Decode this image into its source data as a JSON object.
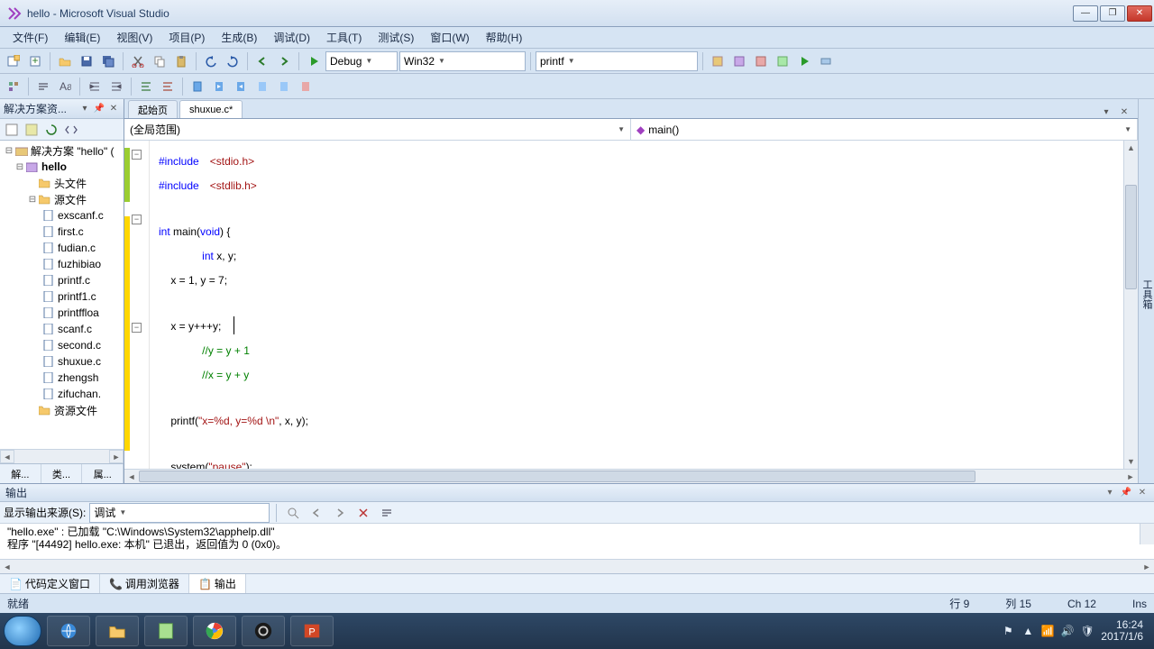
{
  "window": {
    "title": "hello - Microsoft Visual Studio"
  },
  "menu": [
    "文件(F)",
    "编辑(E)",
    "视图(V)",
    "项目(P)",
    "生成(B)",
    "调试(D)",
    "工具(T)",
    "测试(S)",
    "窗口(W)",
    "帮助(H)"
  ],
  "toolbar1": {
    "config": "Debug",
    "platform": "Win32",
    "find": "printf"
  },
  "solution_explorer": {
    "title": "解决方案资...",
    "root": "解决方案 \"hello\" (",
    "project": "hello",
    "folders": {
      "headers": "头文件",
      "sources": "源文件",
      "resources": "资源文件"
    },
    "files": [
      "exscanf.c",
      "first.c",
      "fudian.c",
      "fuzhibiao",
      "printf.c",
      "printf1.c",
      "printffloa",
      "scanf.c",
      "second.c",
      "shuxue.c",
      "zhengsh",
      "zifuchan."
    ],
    "bottom_tabs": [
      "解...",
      "类...",
      "属..."
    ]
  },
  "editor": {
    "tabs": [
      {
        "label": "起始页",
        "active": false
      },
      {
        "label": "shuxue.c*",
        "active": true
      }
    ],
    "scope": "(全局范围)",
    "member": "main()",
    "code_tokens": {
      "l1a": "#include",
      "l1b": "<stdio.h>",
      "l2a": "#include",
      "l2b": "<stdlib.h>",
      "l4a": "int",
      "l4b": " main(",
      "l4c": "void",
      "l4d": ") {",
      "l5a": "int",
      "l5b": " x, y;",
      "l6": "    x = 1, y = 7;",
      "l8": "    x = y+++y;",
      "l9": "//y = y + 1",
      "l10": "//x = y + y",
      "l12a": "    printf(",
      "l12b": "\"x=%d, y=%d \\n\"",
      "l12c": ", x, y);",
      "l14a": "    system(",
      "l14b": "\"pause\"",
      "l14c": ");"
    }
  },
  "output": {
    "title": "输出",
    "source_label": "显示输出来源(S):",
    "source_value": "调试",
    "lines": [
      "\"hello.exe\" : 已加载 \"C:\\Windows\\System32\\apphelp.dll\"",
      "程序 \"[44492] hello.exe: 本机\" 已退出，返回值为 0 (0x0)。"
    ],
    "bottom_tabs": [
      "代码定义窗口",
      "调用浏览器",
      "输出"
    ]
  },
  "status": {
    "ready": "就绪",
    "row": "行 9",
    "col": "列 15",
    "ch": "Ch 12",
    "ins": "Ins"
  },
  "tray": {
    "time": "16:24",
    "date": "2017/1/6"
  },
  "toolbox_label": "工具箱"
}
